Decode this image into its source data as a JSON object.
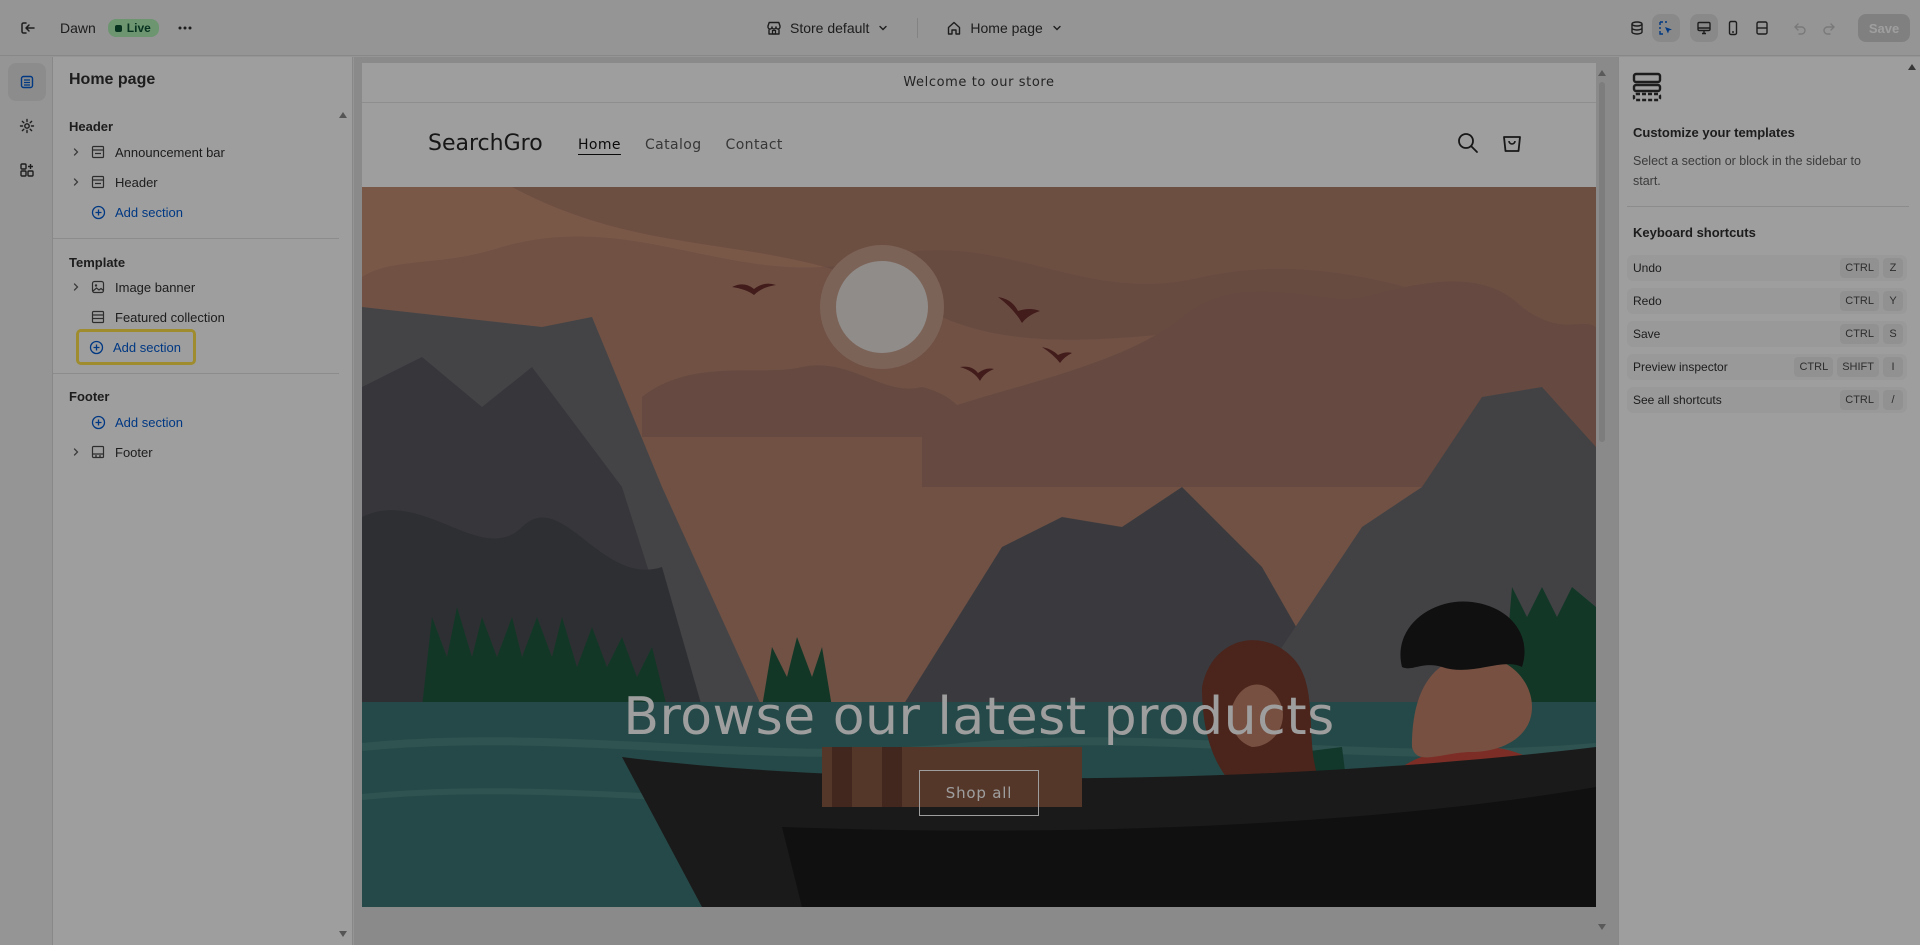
{
  "topbar": {
    "theme_name": "Dawn",
    "live_label": "Live",
    "store_selector": "Store default",
    "page_selector": "Home page",
    "save_label": "Save"
  },
  "sidebar": {
    "title": "Home page",
    "groups": [
      {
        "label": "Header",
        "items": [
          {
            "label": "Announcement bar",
            "icon": "section-icon"
          },
          {
            "label": "Header",
            "icon": "section-icon"
          }
        ],
        "add_label": "Add section"
      },
      {
        "label": "Template",
        "items": [
          {
            "label": "Image banner",
            "icon": "image-section-icon"
          },
          {
            "label": "Featured collection",
            "icon": "collection-icon"
          }
        ],
        "add_label": "Add section"
      },
      {
        "label": "Footer",
        "add_label": "Add section",
        "items": [
          {
            "label": "Footer",
            "icon": "footer-section-icon"
          }
        ]
      }
    ]
  },
  "preview": {
    "announcement": "Welcome to our store",
    "logo": "SearchGro",
    "nav": [
      "Home",
      "Catalog",
      "Contact"
    ],
    "hero_title": "Browse our latest products",
    "hero_button": "Shop all"
  },
  "inspector": {
    "title": "Customize your templates",
    "description": "Select a section or block in the sidebar to start.",
    "shortcuts_title": "Keyboard shortcuts",
    "shortcuts": [
      {
        "label": "Undo",
        "keys": [
          "CTRL",
          "Z"
        ]
      },
      {
        "label": "Redo",
        "keys": [
          "CTRL",
          "Y"
        ]
      },
      {
        "label": "Save",
        "keys": [
          "CTRL",
          "S"
        ]
      },
      {
        "label": "Preview inspector",
        "keys": [
          "CTRL",
          "SHIFT",
          "I"
        ]
      },
      {
        "label": "See all shortcuts",
        "keys": [
          "CTRL",
          "/"
        ]
      }
    ]
  },
  "colors": {
    "accent": "#005bd3",
    "live_bg": "#aff0b5",
    "highlight": "#ffe34d"
  }
}
